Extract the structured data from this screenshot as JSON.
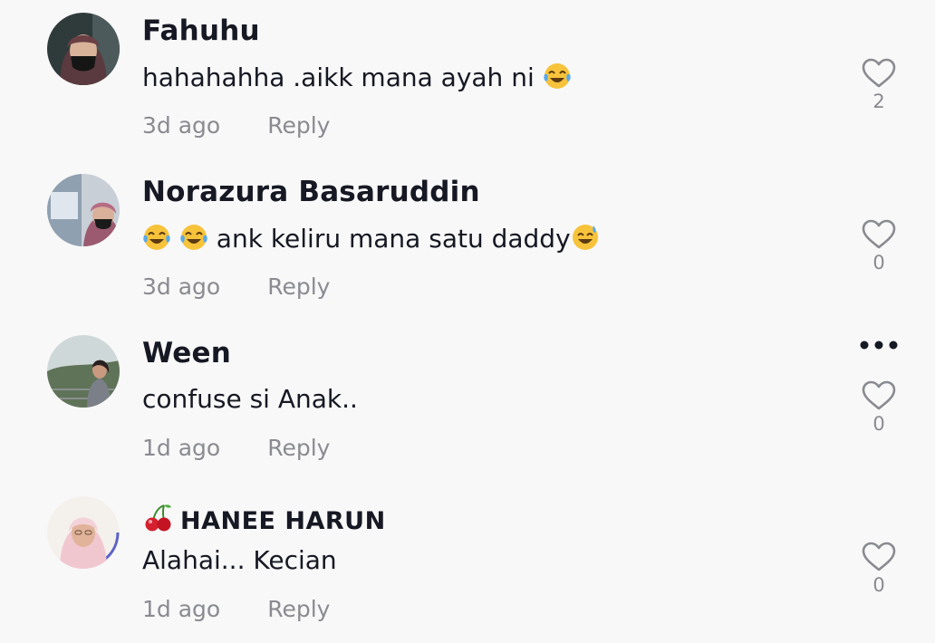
{
  "comments": [
    {
      "username": "Fahuhu",
      "text": "hahahahha .aikk mana ayah ni ",
      "time": "3d ago",
      "reply_label": "Reply",
      "likes": "2"
    },
    {
      "username": "Norazura Basaruddin",
      "text": " ank keliru mana satu daddy",
      "time": "3d ago",
      "reply_label": "Reply",
      "likes": "0"
    },
    {
      "username": "Ween",
      "text": "confuse si Anak..",
      "time": "1d ago",
      "reply_label": "Reply",
      "likes": "0"
    },
    {
      "username": "HANEE HARUN",
      "text": "Alahai... Kecian",
      "time": "1d ago",
      "reply_label": "Reply",
      "likes": "0"
    }
  ],
  "icons": {
    "like": "heart-outline-icon",
    "more": "more-options-icon",
    "laughing": "tears-of-joy-emoji",
    "sweat_smile": "sweat-smile-emoji",
    "cherries": "cherries-emoji"
  },
  "colors": {
    "background": "#f8f8f8",
    "text": "#161823",
    "secondary": "#8a8b91",
    "emoji": "#f7c33b"
  }
}
